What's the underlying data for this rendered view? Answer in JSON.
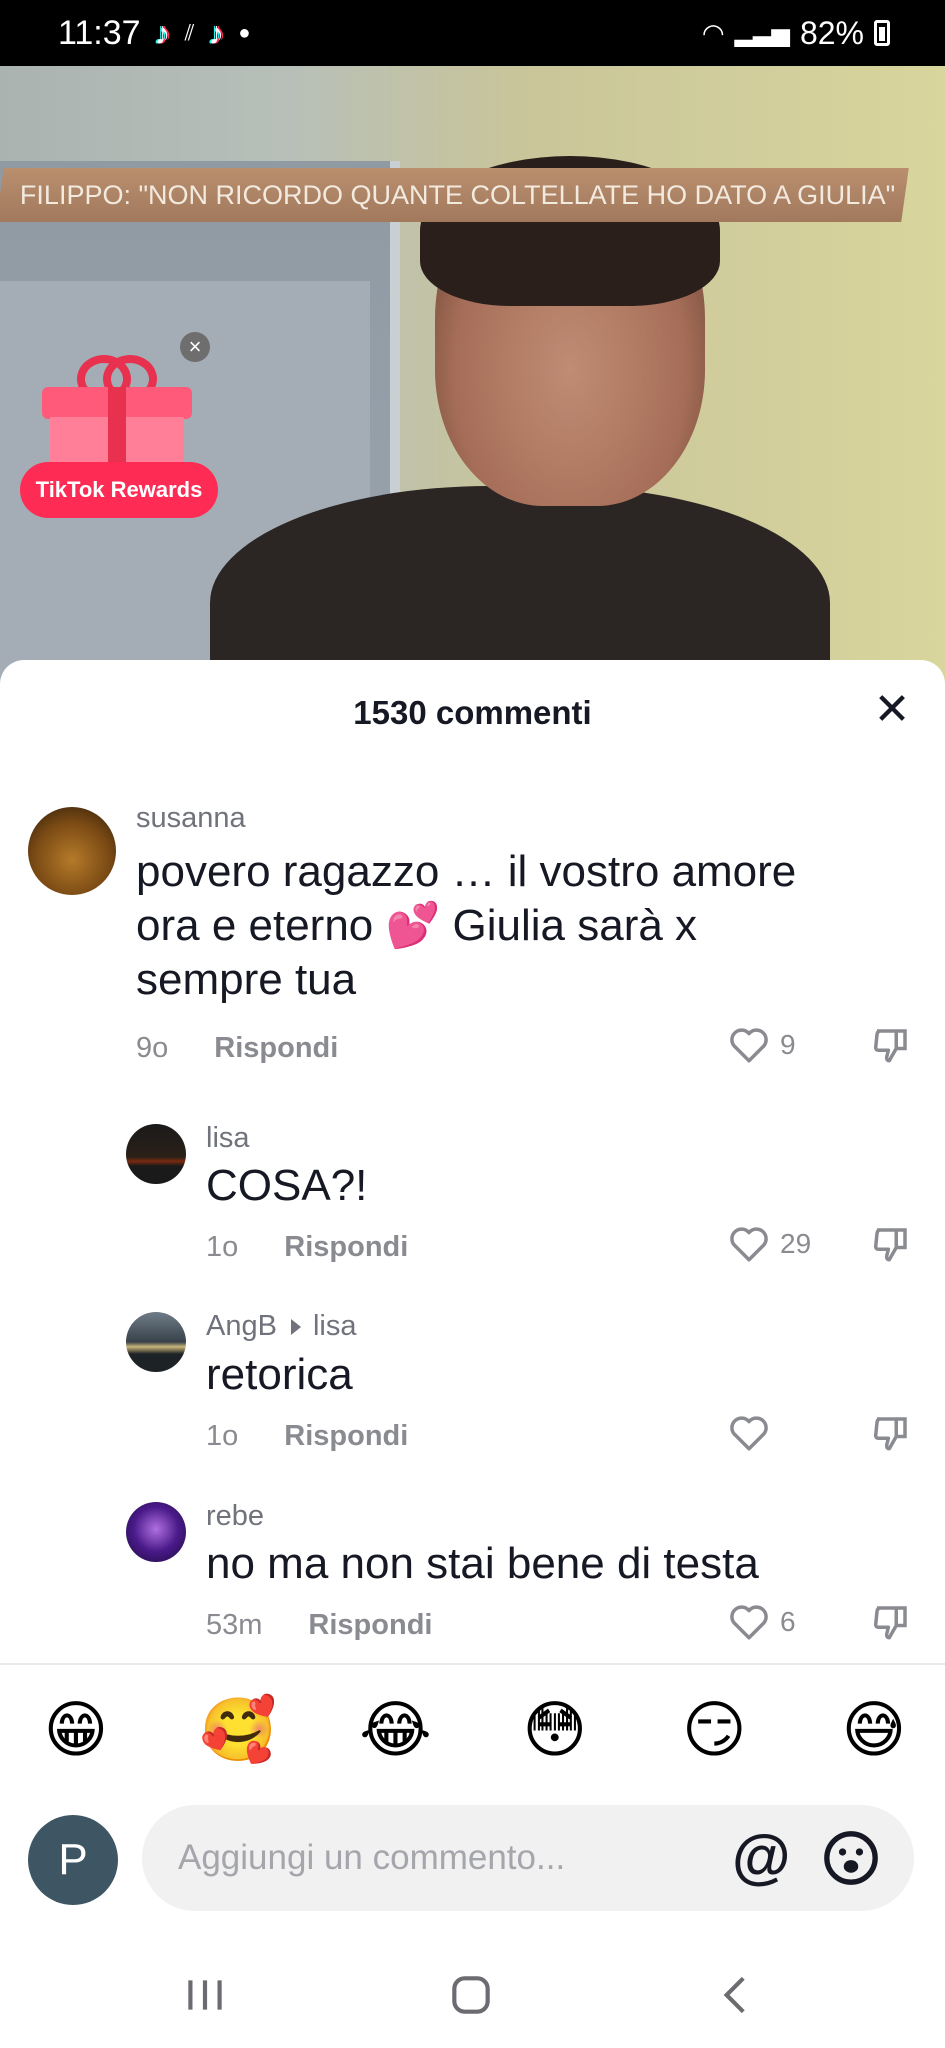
{
  "status_bar": {
    "time": "11:37",
    "battery": "82%",
    "icons": [
      "tiktok-icon",
      "signal-icon",
      "tiktok-icon",
      "dot"
    ]
  },
  "video": {
    "banner_text": "FILIPPO: \"NON RICORDO QUANTE COLTELLATE HO DATO A GIULIA\""
  },
  "rewards": {
    "label": "TikTok Rewards",
    "close": "×"
  },
  "comments_sheet": {
    "title": "1530 commenti",
    "close": "✕",
    "comments": [
      {
        "user": "susanna",
        "text_lines": [
          "povero ragazzo … il vostro amore",
          "ora e eterno 💕 Giulia sarà x",
          "sempre tua"
        ],
        "time": "9o",
        "reply_label": "Rispondi",
        "likes": "9"
      },
      {
        "user": "lisa",
        "text": "COSA?!",
        "time": "1o",
        "reply_label": "Rispondi",
        "likes": "29"
      },
      {
        "user": "AngB",
        "reply_to": "lisa",
        "text": "retorica",
        "time": "1o",
        "reply_label": "Rispondi",
        "likes": ""
      },
      {
        "user": "rebe",
        "text": "no ma non stai bene di testa",
        "time": "53m",
        "reply_label": "Rispondi",
        "likes": "6"
      }
    ]
  },
  "emoji_bar": [
    "😁",
    "🥰",
    "😂",
    "😳",
    "😏",
    "😅"
  ],
  "composer": {
    "avatar_letter": "P",
    "placeholder": "Aggiungi un commento...",
    "at": "@"
  },
  "colors": {
    "accent": "#fe2c55",
    "text_primary": "#161823",
    "text_secondary": "#8a8b91"
  }
}
